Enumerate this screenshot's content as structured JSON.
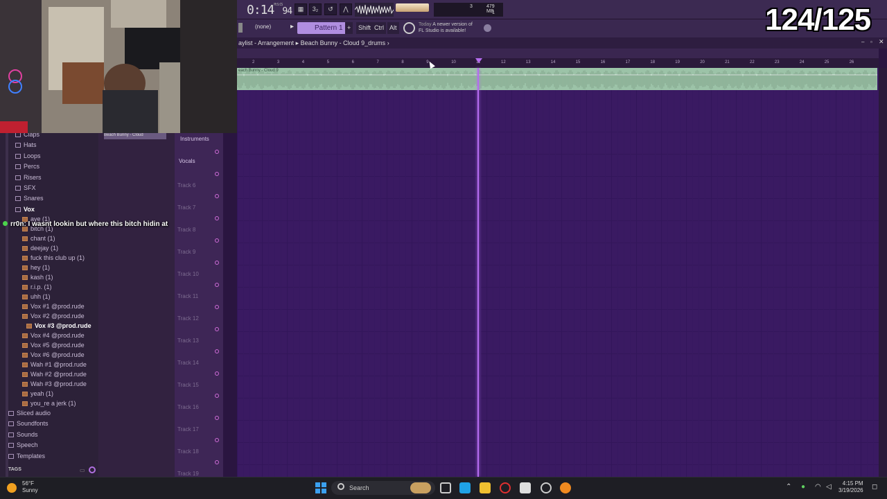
{
  "stream": {
    "counter": "124/125",
    "chat_user": "rr0n",
    "chat_message": ": I wasnt lookin but where this bitch hidin at"
  },
  "transport": {
    "time": "0:14",
    "time_sub": "94",
    "time_unit": "M:S:CS",
    "cpu_num": "3",
    "memory": "479 MB",
    "poly": "1"
  },
  "toolbar2": {
    "none_select": "(none)",
    "pattern": "Pattern 1",
    "plus": "+",
    "shift": "Shift",
    "ctrl": "Ctrl",
    "alt": "Alt",
    "notice_day": "Today",
    "notice_line1": "A newer version of",
    "notice_line2": "FL Studio is available!"
  },
  "playlist": {
    "breadcrumb": "aylist - Arrangement",
    "song": "Beach Bunny - Cloud 9_drums",
    "clip_title": "each Bunny - Cloud 9",
    "ruler": [
      "2",
      "3",
      "4",
      "5",
      "6",
      "7",
      "8",
      "9",
      "10",
      "11",
      "12",
      "13",
      "14",
      "15",
      "16",
      "17",
      "18",
      "19",
      "20",
      "21",
      "22",
      "23",
      "24",
      "25",
      "26"
    ],
    "tracks": [
      "Instruments",
      "Vocals",
      "Track 6",
      "Track 7",
      "Track 8",
      "Track 9",
      "Track 10",
      "Track 11",
      "Track 12",
      "Track 13",
      "Track 14",
      "Track 15",
      "Track 16",
      "Track 17",
      "Track 18",
      "Track 19"
    ]
  },
  "browser": {
    "folders": [
      "Claps",
      "Hats",
      "Loops",
      "Percs",
      "Risers",
      "SFX",
      "Snares",
      "Vox"
    ],
    "files": [
      "aye (1)",
      "bitch (1)",
      "chant (1)",
      "deejay (1)",
      "fuck this club up (1)",
      "hey (1)",
      "kash (1)",
      "r.i.p. (1)",
      "uhh (1)",
      "Vox #1 @prod.rude",
      "Vox #2 @prod.rude",
      "Vox #3 @prod.rude",
      "Vox #4 @prod.rude",
      "Vox #5 @prod.rude",
      "Vox #6 @prod.rude",
      "Wah #1 @prod.rude",
      "Wah #2 @prod.rude",
      "Wah #3 @prod.rude",
      "yeah (1)",
      "you_re a jerk (1)"
    ],
    "roots": [
      "Sliced audio",
      "Soundfonts",
      "Sounds",
      "Speech",
      "Templates"
    ],
    "tags_label": "TAGS",
    "right_panel_label": "Beach Bunny - Cloud"
  },
  "taskbar": {
    "temp": "56°F",
    "condition": "Sunny",
    "search": "Search",
    "time": "4:15 PM",
    "date": "3/19/2026"
  }
}
